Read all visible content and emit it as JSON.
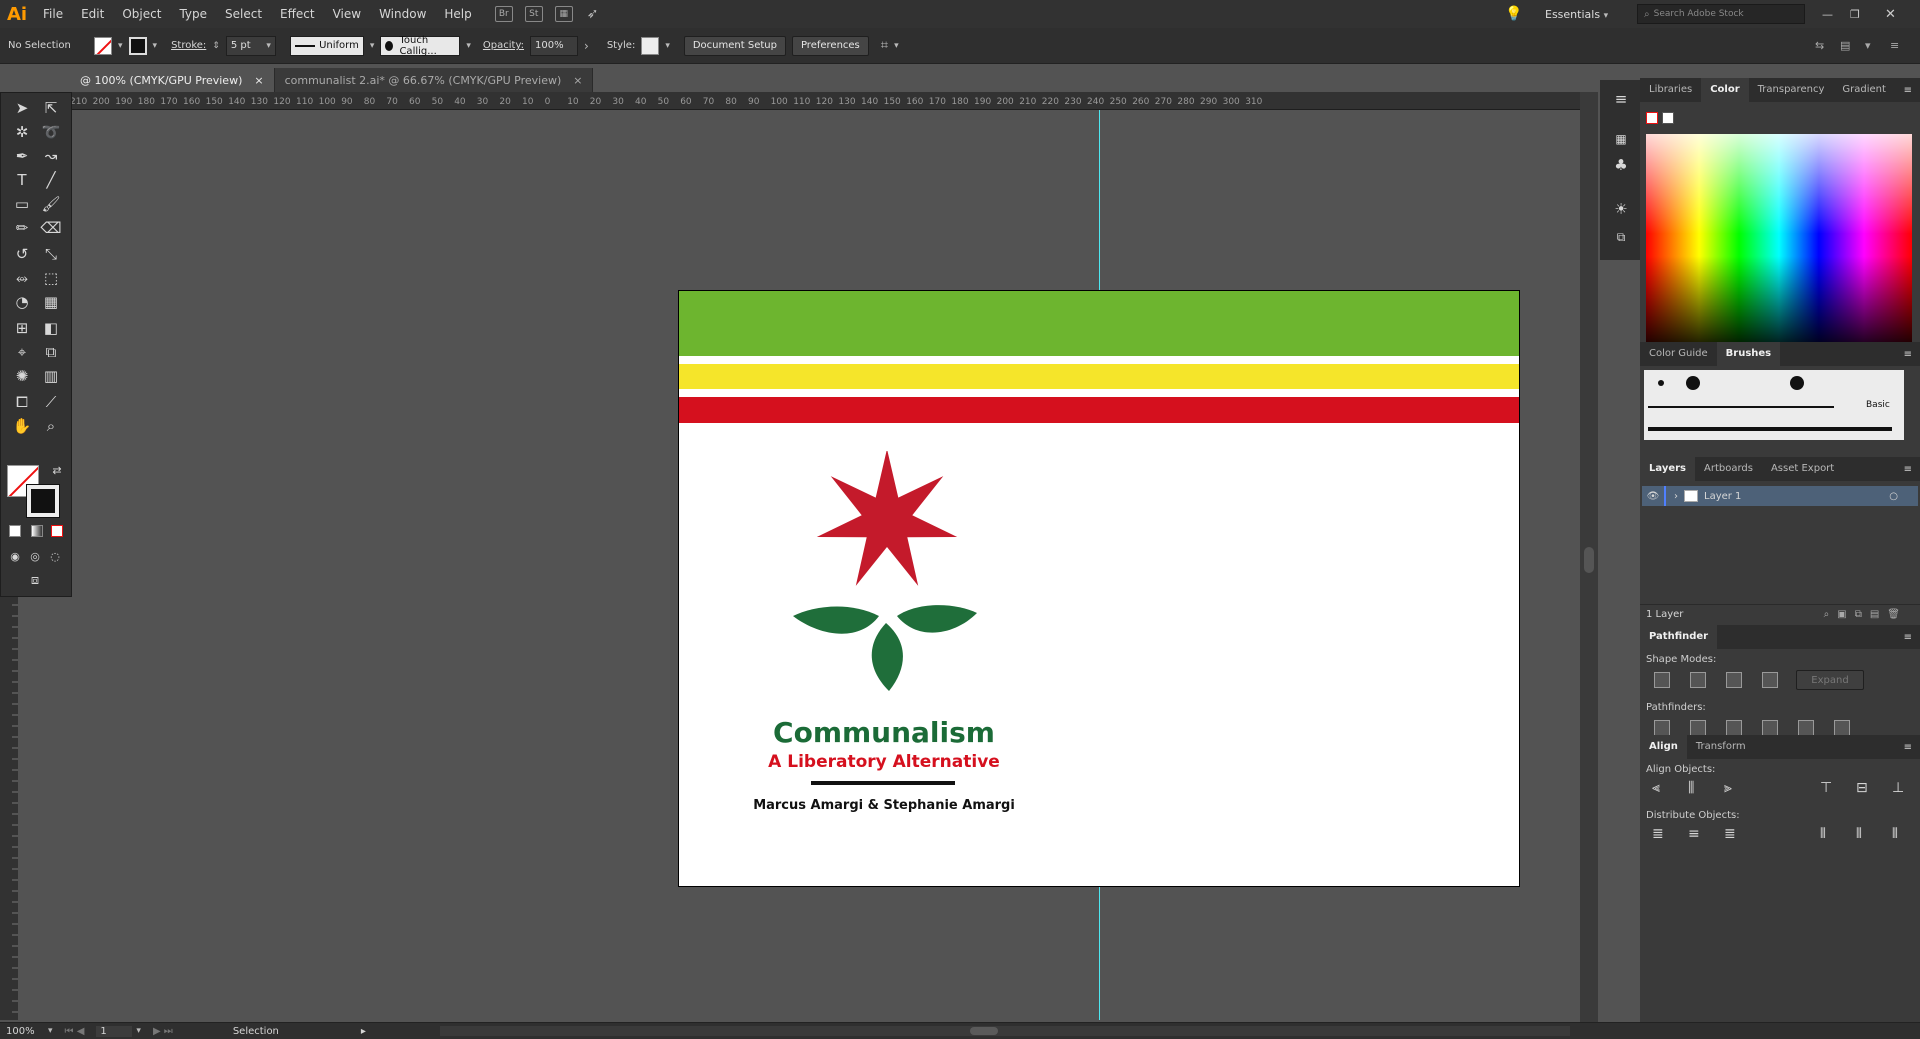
{
  "app": {
    "logo": "Ai"
  },
  "menu": [
    "File",
    "Edit",
    "Object",
    "Type",
    "Select",
    "Effect",
    "View",
    "Window",
    "Help"
  ],
  "menubar_icons": {
    "bridge": "Br",
    "stock": "St"
  },
  "workspace": "Essentials",
  "search": {
    "placeholder": "Search Adobe Stock"
  },
  "control_bar": {
    "selection": "No Selection",
    "stroke_label": "Stroke:",
    "stroke_value": "5 pt",
    "profile": "Uniform",
    "brush": "Touch Callig...",
    "opacity_label": "Opacity:",
    "opacity_value": "100%",
    "style_label": "Style:",
    "doc_setup": "Document Setup",
    "preferences": "Preferences"
  },
  "tabs": [
    {
      "label": "@ 100% (CMYK/GPU Preview)",
      "active": true
    },
    {
      "label": "communalist 2.ai* @ 66.67% (CMYK/GPU Preview)",
      "active": false
    }
  ],
  "ruler_ticks": [
    "210",
    "200",
    "190",
    "180",
    "170",
    "160",
    "150",
    "140",
    "130",
    "120",
    "110",
    "100",
    "90",
    "80",
    "70",
    "60",
    "50",
    "40",
    "30",
    "20",
    "10",
    "0",
    "10",
    "20",
    "30",
    "40",
    "50",
    "60",
    "70",
    "80",
    "90",
    "100",
    "110",
    "120",
    "130",
    "140",
    "150",
    "160",
    "170",
    "180",
    "190",
    "200",
    "210",
    "220",
    "230",
    "240",
    "250",
    "260",
    "270",
    "280",
    "290",
    "300",
    "310"
  ],
  "artwork": {
    "title": "Communalism",
    "subtitle": "A Liberatory Alternative",
    "authors": "Marcus Amargi & Stephanie Amargi",
    "colors": {
      "green": "#6db52f",
      "yellow": "#f5e52a",
      "red": "#d5101e",
      "star": "#c41a2b",
      "leaf": "#1f6e3a",
      "title": "#1b6b37"
    }
  },
  "panels": {
    "color_tabs": [
      "Libraries",
      "Color",
      "Transparency",
      "Gradient"
    ],
    "brush_tabs": [
      "Color Guide",
      "Brushes"
    ],
    "brush_basic": "Basic",
    "layer_tabs": [
      "Layers",
      "Artboards",
      "Asset Export"
    ],
    "layer_name": "Layer 1",
    "layer_count": "1 Layer",
    "pathfinder_title": "Pathfinder",
    "shape_modes": "Shape Modes:",
    "expand": "Expand",
    "pathfinders": "Pathfinders:",
    "align_tabs": [
      "Align",
      "Transform"
    ],
    "align_objects": "Align Objects:",
    "distribute_objects": "Distribute Objects:"
  },
  "status": {
    "zoom": "100%",
    "artboard": "1",
    "tool": "Selection"
  }
}
